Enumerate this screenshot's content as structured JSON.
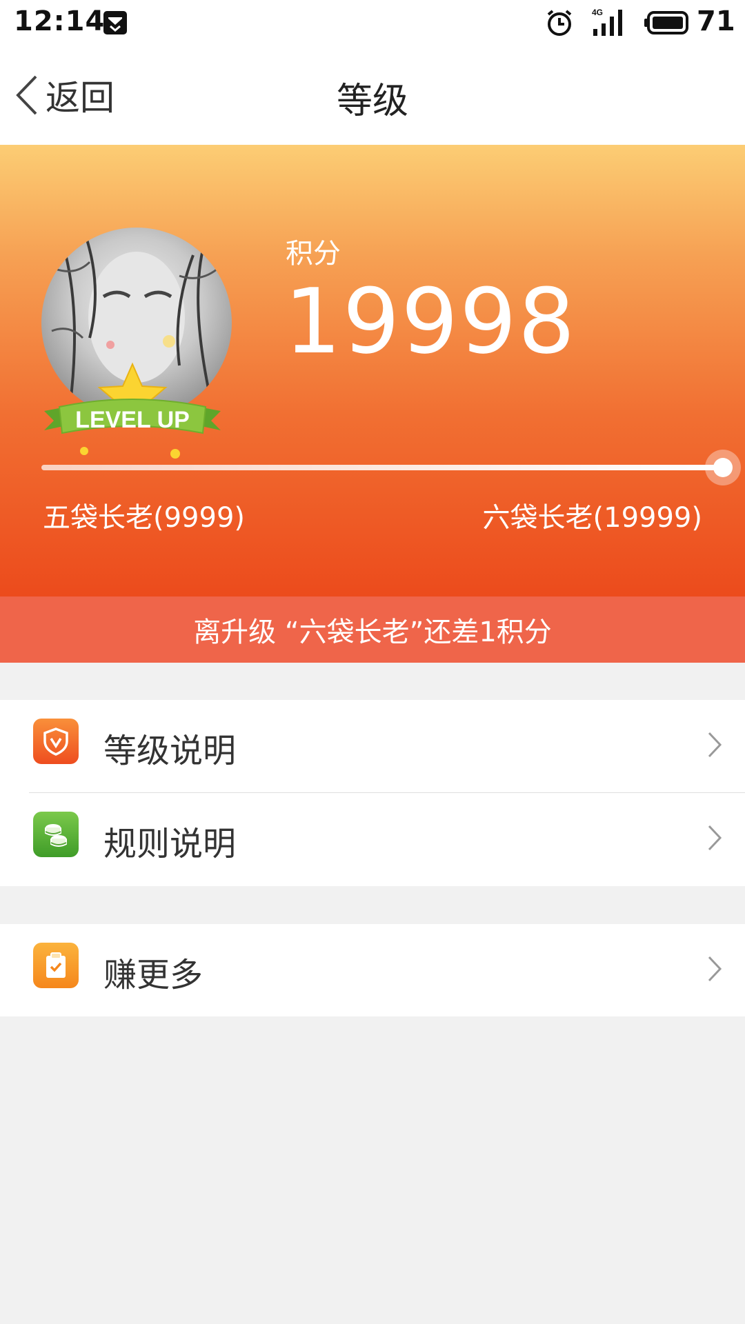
{
  "status_bar": {
    "time": "12:14",
    "network": "4G",
    "battery_level": "71"
  },
  "nav": {
    "back_label": "返回",
    "title": "等级"
  },
  "level": {
    "score_label": "积分",
    "score": "19998",
    "badge_text": "LEVEL UP",
    "current_level": "五袋长老(9999)",
    "next_level": "六袋长老(19999)",
    "progress": 0.9999,
    "upgrade_hint": "离升级 “六袋长老”还差1积分"
  },
  "menu": {
    "group1": [
      {
        "label": "等级说明",
        "icon": "shield-icon"
      },
      {
        "label": "规则说明",
        "icon": "coins-icon"
      }
    ],
    "group2": [
      {
        "label": "赚更多",
        "icon": "clipboard-check-icon"
      }
    ]
  },
  "colors": {
    "header_top": "#fccd74",
    "header_bottom": "#ec4b1c",
    "banner": "#ef654a",
    "page_background": "#f1f1f1"
  }
}
